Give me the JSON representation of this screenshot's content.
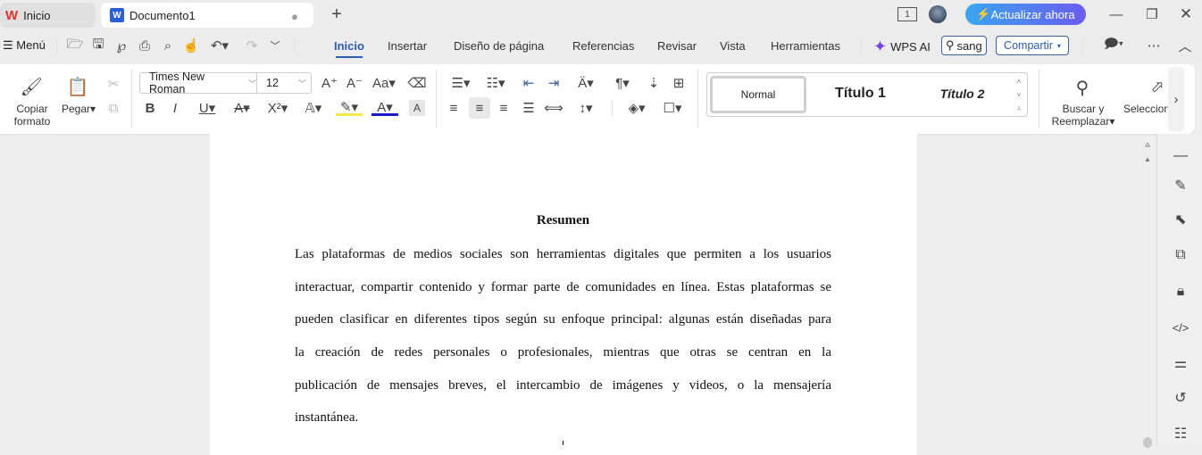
{
  "tabs": {
    "home": "Inicio",
    "document": "Documento1",
    "new_tab": "+"
  },
  "titlebar": {
    "upgrade": "Actualizar ahora",
    "page_count": "1"
  },
  "menubar": {
    "menu": "Menú",
    "tabs": [
      "Inicio",
      "Insertar",
      "Diseño de página",
      "Referencias",
      "Revisar",
      "Vista",
      "Herramientas"
    ],
    "active_tab": "Inicio",
    "wps_ai": "WPS AI",
    "search_value": "sang",
    "share": "Compartir"
  },
  "ribbon": {
    "copy_format": "Copiar formato",
    "paste": "Pegar",
    "font_name": "Times New Roman",
    "font_size": "12",
    "styles": [
      "Normal",
      "Título 1",
      "Título 2"
    ],
    "find_replace": "Buscar y Reemplazar",
    "select": "Seleccion"
  },
  "document": {
    "heading": "Resumen",
    "lines": [
      "Las plataformas de medios sociales son herramientas digitales que permiten a los usuarios",
      "interactuar, compartir contenido y formar parte de comunidades en línea. Estas plataformas se",
      "pueden clasificar en diferentes tipos según su enfoque principal: algunas están diseñadas para",
      "la creación de redes personales o profesionales, mientras que otras se centran en la",
      "publicación de mensajes breves, el intercambio de imágenes y videos, o la mensajería",
      "instantánea."
    ]
  },
  "colors": {
    "accent": "#2a5bb7",
    "upgrade_gradient": [
      "#3aa6f0",
      "#6a5cf0"
    ],
    "logo": "#e0332c"
  }
}
